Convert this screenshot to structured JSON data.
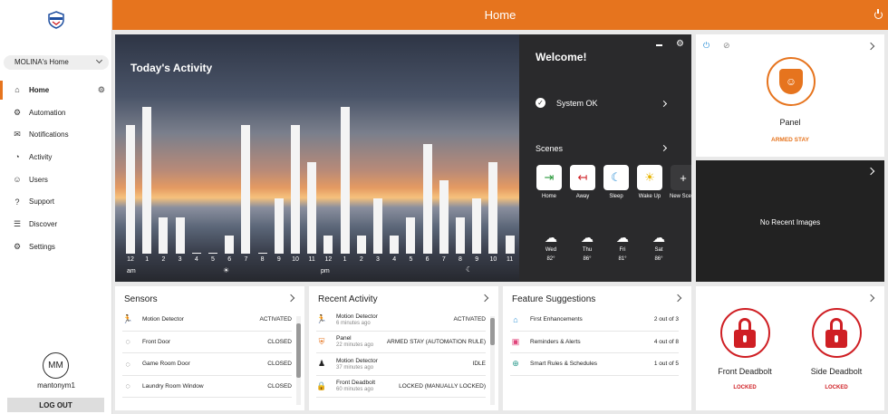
{
  "header": {
    "title": "Home",
    "power_icon": "power-icon"
  },
  "brand": {
    "accent": "#e6741e",
    "lock_red": "#cf1f24"
  },
  "sidebar": {
    "home_selector": "MOLINA's Home",
    "items": [
      {
        "label": "Home",
        "icon": "home-icon",
        "glyph": "⌂"
      },
      {
        "label": "Automation",
        "icon": "sliders-icon",
        "glyph": "⚙"
      },
      {
        "label": "Notifications",
        "icon": "notifications-icon",
        "glyph": "✉"
      },
      {
        "label": "Activity",
        "icon": "activity-icon",
        "glyph": "◔"
      },
      {
        "label": "Users",
        "icon": "users-icon",
        "glyph": "☺"
      },
      {
        "label": "Support",
        "icon": "support-icon",
        "glyph": "?"
      },
      {
        "label": "Discover",
        "icon": "discover-icon",
        "glyph": "☰"
      },
      {
        "label": "Settings",
        "icon": "settings-icon",
        "glyph": "⚙"
      }
    ],
    "avatar_initials": "MM",
    "username": "mantonym1",
    "logout_label": "LOG OUT"
  },
  "activity": {
    "title": "Today's Activity",
    "am_label": "am",
    "pm_label": "pm",
    "hours": [
      "12",
      "1",
      "2",
      "3",
      "4",
      "5",
      "6",
      "7",
      "8",
      "9",
      "10",
      "11",
      "12",
      "1",
      "2",
      "3",
      "4",
      "5",
      "6",
      "7",
      "8",
      "9",
      "10",
      "11"
    ],
    "counts": [
      7,
      8,
      2,
      2,
      0,
      0,
      1,
      7,
      0,
      3,
      7,
      5,
      1,
      8,
      1,
      3,
      1,
      2,
      6,
      4,
      2,
      3,
      5,
      1
    ],
    "max": 8
  },
  "welcome": {
    "title": "Welcome!",
    "status": "System OK",
    "scenes_label": "Scenes",
    "scenes": [
      {
        "label": "Home",
        "icon": "home-scene-icon",
        "glyph": "⇥",
        "color": "#2b9a3c"
      },
      {
        "label": "Away",
        "icon": "away-scene-icon",
        "glyph": "↤",
        "color": "#cf1f24"
      },
      {
        "label": "Sleep",
        "icon": "sleep-scene-icon",
        "glyph": "☾",
        "color": "#2a8fd6"
      },
      {
        "label": "Wake Up",
        "icon": "wakeup-scene-icon",
        "glyph": "☀",
        "color": "#e8b400"
      },
      {
        "label": "New Scene",
        "icon": "add-scene-icon",
        "glyph": "+",
        "color": "#333333"
      }
    ],
    "forecast": [
      {
        "day": "Wed",
        "temp": "82°",
        "icon": "storm-cloud-icon",
        "glyph": "☁"
      },
      {
        "day": "Thu",
        "temp": "86°",
        "icon": "storm-cloud-icon",
        "glyph": "☁"
      },
      {
        "day": "Fri",
        "temp": "81°",
        "icon": "storm-cloud-icon",
        "glyph": "☁"
      },
      {
        "day": "Sat",
        "temp": "86°",
        "icon": "cloud-icon",
        "glyph": "☁"
      }
    ]
  },
  "panel": {
    "name": "Panel",
    "status": "ARMED STAY"
  },
  "images": {
    "message": "No Recent Images"
  },
  "sensors": {
    "title": "Sensors",
    "rows": [
      {
        "name": "Motion Detector",
        "value": "ACTIVATED",
        "icon": "motion-icon",
        "glyph": "🏃"
      },
      {
        "name": "Front Door",
        "value": "CLOSED",
        "icon": "door-sensor-icon",
        "glyph": "◌"
      },
      {
        "name": "Game Room Door",
        "value": "CLOSED",
        "icon": "door-sensor-icon",
        "glyph": "◌"
      },
      {
        "name": "Laundry Room Window",
        "value": "CLOSED",
        "icon": "window-sensor-icon",
        "glyph": "◌"
      }
    ]
  },
  "recent": {
    "title": "Recent Activity",
    "rows": [
      {
        "name": "Motion Detector",
        "time": "6 minutes ago",
        "value": "ACTIVATED",
        "icon": "motion-icon",
        "glyph": "🏃"
      },
      {
        "name": "Panel",
        "time": "22 minutes ago",
        "value": "ARMED STAY (AUTOMATION RULE)",
        "icon": "panel-shield-icon",
        "glyph": "⛨"
      },
      {
        "name": "Motion Detector",
        "time": "37 minutes ago",
        "value": "IDLE",
        "icon": "person-icon",
        "glyph": "♟"
      },
      {
        "name": "Front Deadbolt",
        "time": "60 minutes ago",
        "value": "LOCKED (MANUALLY LOCKED)",
        "icon": "lock-icon",
        "glyph": "🔒"
      }
    ]
  },
  "features": {
    "title": "Feature Suggestions",
    "rows": [
      {
        "name": "First Enhancements",
        "value": "2 out of 3",
        "icon": "home-outline-icon",
        "glyph": "⌂"
      },
      {
        "name": "Reminders & Alerts",
        "value": "4 out of 8",
        "icon": "calendar-icon",
        "glyph": "▣"
      },
      {
        "name": "Smart Rules & Schedules",
        "value": "1 out of 5",
        "icon": "rules-icon",
        "glyph": "⊕"
      }
    ]
  },
  "locks": [
    {
      "name": "Front Deadbolt",
      "status": "LOCKED"
    },
    {
      "name": "Side Deadbolt",
      "status": "LOCKED"
    }
  ]
}
